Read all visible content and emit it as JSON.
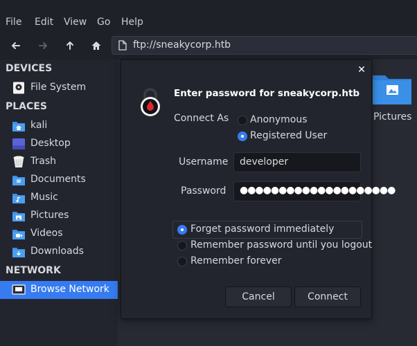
{
  "menubar": {
    "items": [
      "File",
      "Edit",
      "View",
      "Go",
      "Help"
    ]
  },
  "toolbar": {
    "location": "ftp://sneakycorp.htb"
  },
  "sidebar": {
    "sections": [
      "DEVICES",
      "PLACES",
      "NETWORK"
    ],
    "devices": [
      {
        "label": "File System",
        "icon": "drive-icon"
      }
    ],
    "places": [
      {
        "label": "kali",
        "icon": "home-folder-icon"
      },
      {
        "label": "Desktop",
        "icon": "desktop-icon"
      },
      {
        "label": "Trash",
        "icon": "trash-icon"
      },
      {
        "label": "Documents",
        "icon": "documents-folder-icon"
      },
      {
        "label": "Music",
        "icon": "music-folder-icon"
      },
      {
        "label": "Pictures",
        "icon": "pictures-folder-icon"
      },
      {
        "label": "Videos",
        "icon": "videos-folder-icon"
      },
      {
        "label": "Downloads",
        "icon": "downloads-folder-icon"
      }
    ],
    "network": [
      {
        "label": "Browse Network",
        "icon": "network-icon",
        "selected": true
      }
    ]
  },
  "content": {
    "items": [
      {
        "label": "Pictures",
        "icon": "pictures-folder-icon"
      }
    ]
  },
  "dialog": {
    "title": "Enter password for sneakycorp.htb",
    "connect_as_label": "Connect As",
    "connect_as_options": [
      {
        "label": "Anonymous",
        "selected": false
      },
      {
        "label": "Registered User",
        "selected": true
      }
    ],
    "username_label": "Username",
    "username_value": "developer",
    "password_label": "Password",
    "password_value": "●●●●●●●●●●●●●●●●●●●●",
    "remember_options": [
      {
        "label": "Forget password immediately",
        "selected": true
      },
      {
        "label": "Remember password until you logout",
        "selected": false
      },
      {
        "label": "Remember forever",
        "selected": false
      }
    ],
    "cancel_label": "Cancel",
    "connect_label": "Connect"
  },
  "colors": {
    "accent": "#367bf0",
    "background": "#23252e",
    "folder": "#3a8fe6"
  }
}
